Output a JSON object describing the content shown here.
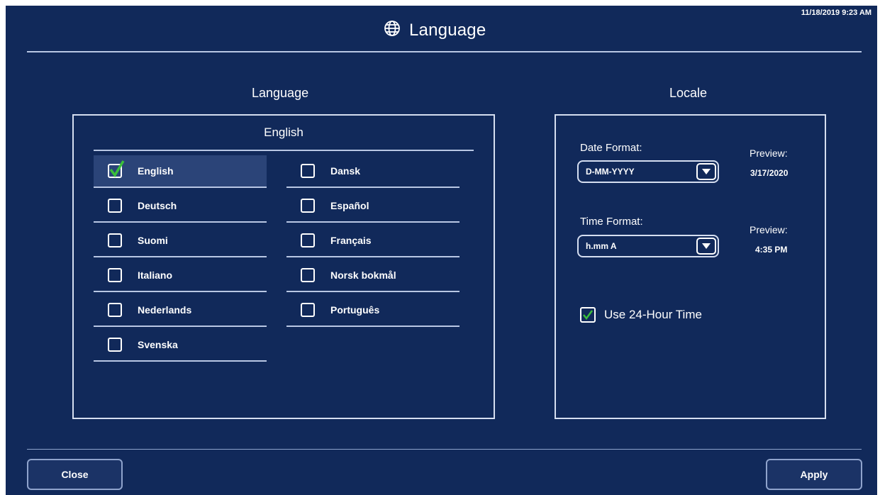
{
  "header": {
    "title": "Language",
    "timestamp": "11/18/2019 9:23 AM",
    "icon": "globe-icon"
  },
  "language_section": {
    "title": "Language",
    "current": "English",
    "left_items": [
      {
        "label": "English",
        "checked": true
      },
      {
        "label": "Deutsch",
        "checked": false
      },
      {
        "label": "Suomi",
        "checked": false
      },
      {
        "label": "Italiano",
        "checked": false
      },
      {
        "label": "Nederlands",
        "checked": false
      },
      {
        "label": "Svenska",
        "checked": false
      }
    ],
    "right_items": [
      {
        "label": "Dansk",
        "checked": false
      },
      {
        "label": "Español",
        "checked": false
      },
      {
        "label": "Français",
        "checked": false
      },
      {
        "label": "Norsk bokmål",
        "checked": false
      },
      {
        "label": "Português",
        "checked": false
      }
    ]
  },
  "locale_section": {
    "title": "Locale",
    "date_format_label": "Date Format:",
    "date_format_value": "D-MM-YYYY",
    "date_preview_label": "Preview:",
    "date_preview_value": "3/17/2020",
    "time_format_label": "Time Format:",
    "time_format_value": "h.mm A",
    "time_preview_label": "Preview:",
    "time_preview_value": "4:35 PM",
    "use_24_hour_label": "Use 24-Hour Time",
    "use_24_hour_checked": true
  },
  "footer": {
    "close_label": "Close",
    "apply_label": "Apply"
  },
  "colors": {
    "background": "#11295a",
    "check": "#3bbf3b",
    "selected_row": "#2b4478"
  }
}
